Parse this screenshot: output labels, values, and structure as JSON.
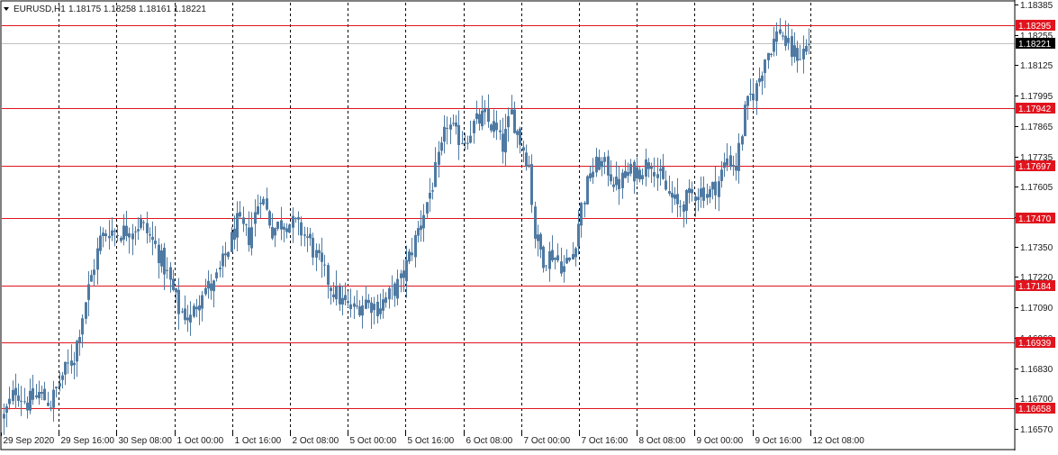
{
  "header": {
    "symbol_timeframe": "EURUSD,H1",
    "ohlc": "1.18175 1.18258 1.18161 1.18221",
    "dropdown_icon": "triangle-down-icon"
  },
  "colors": {
    "candle": "#4f7aa3",
    "level_line": "#e0141e",
    "level_label_bg": "#e0141e",
    "current_price_bg": "#000000",
    "grid": "#000000",
    "frame": "#000000"
  },
  "chart_data": {
    "type": "candlestick",
    "symbol": "EURUSD",
    "timeframe": "H1",
    "ylim": [
      1.1657,
      1.18385
    ],
    "y_ticks": [
      "1.18385",
      "1.18255",
      "1.18125",
      "1.17995",
      "1.17865",
      "1.17735",
      "1.17605",
      "1.17475",
      "1.17350",
      "1.17220",
      "1.17090",
      "1.16960",
      "1.16830",
      "1.16700",
      "1.16570"
    ],
    "x_ticks": [
      "29 Sep 2020",
      "29 Sep 16:00",
      "30 Sep 08:00",
      "1 Oct 00:00",
      "1 Oct 16:00",
      "2 Oct 08:00",
      "5 Oct 00:00",
      "5 Oct 16:00",
      "6 Oct 08:00",
      "7 Oct 00:00",
      "7 Oct 16:00",
      "8 Oct 08:00",
      "9 Oct 00:00",
      "9 Oct 16:00",
      "12 Oct 08:00"
    ],
    "grid": true,
    "horizontal_levels": [
      1.18295,
      1.17942,
      1.17697,
      1.1747,
      1.17184,
      1.16939,
      1.16658
    ],
    "current_price": 1.18221,
    "close_path": [
      [
        0,
        1.1662
      ],
      [
        4,
        1.1674
      ],
      [
        8,
        1.1668
      ],
      [
        12,
        1.1672
      ],
      [
        16,
        1.1668
      ],
      [
        20,
        1.168
      ],
      [
        24,
        1.1688
      ],
      [
        28,
        1.1712
      ],
      [
        30,
        1.1722
      ],
      [
        33,
        1.1738
      ],
      [
        36,
        1.1742
      ],
      [
        40,
        1.1741
      ],
      [
        44,
        1.1743
      ],
      [
        47,
        1.1745
      ],
      [
        52,
        1.1735
      ],
      [
        56,
        1.1723
      ],
      [
        60,
        1.1708
      ],
      [
        64,
        1.1704
      ],
      [
        68,
        1.1717
      ],
      [
        72,
        1.1718
      ],
      [
        76,
        1.1731
      ],
      [
        80,
        1.1745
      ],
      [
        84,
        1.1739
      ],
      [
        88,
        1.1758
      ],
      [
        92,
        1.1742
      ],
      [
        96,
        1.1746
      ],
      [
        100,
        1.1744
      ],
      [
        104,
        1.1739
      ],
      [
        108,
        1.1728
      ],
      [
        112,
        1.1718
      ],
      [
        116,
        1.1711
      ],
      [
        120,
        1.1708
      ],
      [
        124,
        1.1712
      ],
      [
        128,
        1.1709
      ],
      [
        132,
        1.1714
      ],
      [
        136,
        1.172
      ],
      [
        140,
        1.1734
      ],
      [
        144,
        1.175
      ],
      [
        147,
        1.1762
      ],
      [
        150,
        1.1776
      ],
      [
        152,
        1.1788
      ],
      [
        155,
        1.1782
      ],
      [
        158,
        1.1781
      ],
      [
        161,
        1.1787
      ],
      [
        164,
        1.179
      ],
      [
        168,
        1.1786
      ],
      [
        171,
        1.1778
      ],
      [
        174,
        1.1792
      ],
      [
        176,
        1.1784
      ],
      [
        180,
        1.177
      ],
      [
        182,
        1.174
      ],
      [
        185,
        1.173
      ],
      [
        188,
        1.1732
      ],
      [
        192,
        1.1726
      ],
      [
        195,
        1.1732
      ],
      [
        198,
        1.1752
      ],
      [
        201,
        1.1766
      ],
      [
        204,
        1.1771
      ],
      [
        207,
        1.1768
      ],
      [
        210,
        1.1761
      ],
      [
        214,
        1.1766
      ],
      [
        218,
        1.1768
      ],
      [
        222,
        1.1772
      ],
      [
        225,
        1.1764
      ],
      [
        228,
        1.1757
      ],
      [
        231,
        1.1752
      ],
      [
        234,
        1.1755
      ],
      [
        238,
        1.1759
      ],
      [
        242,
        1.1758
      ],
      [
        245,
        1.1763
      ],
      [
        248,
        1.1773
      ],
      [
        251,
        1.1769
      ],
      [
        254,
        1.1792
      ],
      [
        256,
        1.1799
      ],
      [
        258,
        1.1803
      ],
      [
        261,
        1.1816
      ],
      [
        264,
        1.1823
      ],
      [
        266,
        1.1828
      ],
      [
        268,
        1.1822
      ],
      [
        270,
        1.1818
      ],
      [
        273,
        1.1817
      ],
      [
        276,
        1.1822
      ]
    ]
  }
}
